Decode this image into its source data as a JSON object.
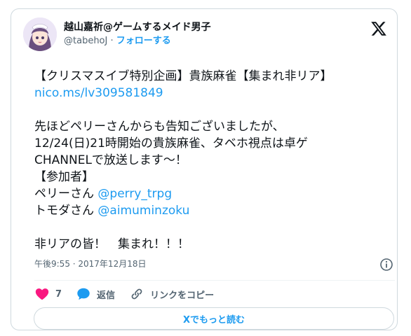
{
  "author": {
    "display_name": "越山嘉祈@ゲームするメイド男子",
    "handle": "@tabehoJ",
    "separator": " · ",
    "follow_label": "フォローする"
  },
  "tweet": {
    "line1": "【クリスマスイブ特別企画】貴族麻雀【集まれ非リア】",
    "link_url": "nico.ms/lv309581849",
    "paragraph": "先ほどペリーさんからも告知ございましたが、\n12/24(日)21時開始の貴族麻雀、タベホ視点は卓ゲ\nCHANNELで放送します〜！\n【参加者】",
    "participant1_prefix": "ペリーさん ",
    "participant1_mention": "@perry_trpg",
    "participant2_prefix": "トモダさん ",
    "participant2_mention": "@aimuminzoku",
    "closing": "非リアの皆！　集まれ！！！"
  },
  "meta": {
    "timestamp": "午後9:55 · 2017年12月18日"
  },
  "actions": {
    "like_count": "7",
    "reply_label": "返信",
    "copy_link_label": "リンクをコピー"
  },
  "read_more_label": "Xでもっと読む",
  "icons": {
    "logo": "x-logo-icon",
    "info": "info-icon",
    "like": "heart-icon",
    "reply": "reply-bubble-icon",
    "copy": "link-icon"
  },
  "colors": {
    "accent": "#1d9bf0",
    "like": "#f91880",
    "text": "#0f1419",
    "muted": "#536471",
    "border": "#cfd9de"
  }
}
